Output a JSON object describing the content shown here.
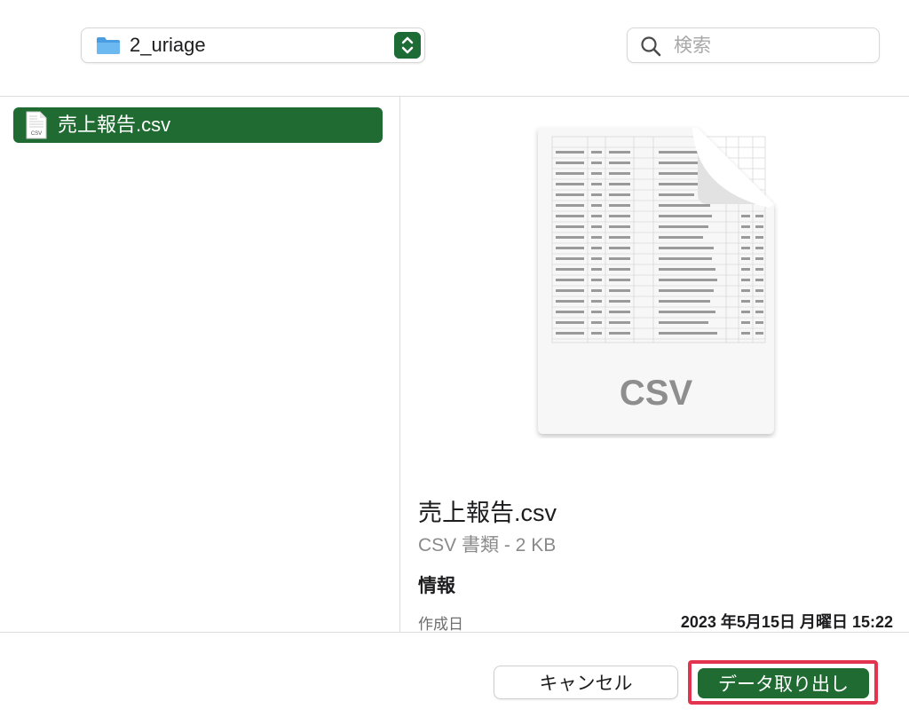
{
  "toolbar": {
    "location": {
      "folder_name": "2_uriage",
      "icon": "folder-icon"
    },
    "search": {
      "placeholder": "検索",
      "value": "",
      "icon": "search-icon"
    }
  },
  "file_list": {
    "items": [
      {
        "name": "売上報告.csv",
        "icon": "csv-document-icon",
        "selected": true
      }
    ]
  },
  "preview": {
    "icon_label": "CSV",
    "file_name": "売上報告.csv",
    "kind_and_size": "CSV 書類 - 2 KB",
    "info_heading": "情報",
    "created_label": "作成日",
    "created_value": "2023 年5月15日 月曜日 15:22"
  },
  "footer": {
    "cancel_label": "キャンセル",
    "primary_label": "データ取り出し"
  },
  "colors": {
    "accent": "#1f6b32",
    "highlight": "#e3344f",
    "folder": "#5aa9e6"
  }
}
